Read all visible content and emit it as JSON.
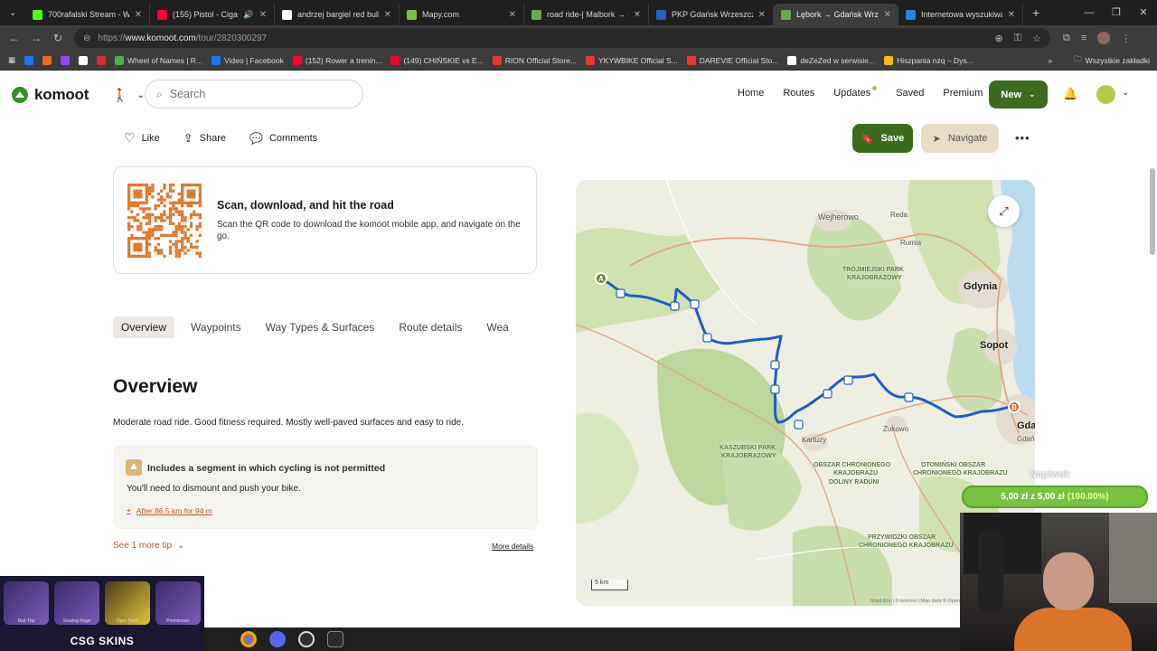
{
  "browser": {
    "tabs": [
      {
        "title": "700rafalski Stream - Watc",
        "color": "#53fc18"
      },
      {
        "title": "(155) Pistol - Cigarett",
        "color": "#ff0033",
        "audio": "🔊"
      },
      {
        "title": "andrzej bargiel red bull p",
        "color": "#ffffff"
      },
      {
        "title": "Mapy.com",
        "color": "#7bc043"
      },
      {
        "title": "road ride-| Malbork → Gd",
        "color": "#6aa84f"
      },
      {
        "title": "PKP Gdańsk Wrzeszcz > l",
        "color": "#2a5dbe"
      },
      {
        "title": "Lębork → Gdańsk Wrzesz",
        "color": "#6aa84f"
      },
      {
        "title": "Internetowa wyszukiwark",
        "color": "#1e88e5"
      }
    ],
    "url_prefix": "https://",
    "url_host": "www.komoot.com",
    "url_path": "/tour/2820300297",
    "bookmarks": [
      {
        "label": "",
        "color": "#1877f2"
      },
      {
        "label": "",
        "color": "#f06a2a"
      },
      {
        "label": "",
        "color": "#9146ff"
      },
      {
        "label": "",
        "color": "#ffffff"
      },
      {
        "label": "",
        "color": "#d32f2f"
      },
      {
        "label": "Wheel of Names | R...",
        "color": "#4caf50"
      },
      {
        "label": "Video | Facebook",
        "color": "#1877f2"
      },
      {
        "label": "(152) Rower a trenin...",
        "color": "#ff0033"
      },
      {
        "label": "(149) CHIŃSKIE vs E...",
        "color": "#ff0033"
      },
      {
        "label": "RION Official Store...",
        "color": "#e53935"
      },
      {
        "label": "YKYWBIKE Official S...",
        "color": "#e53935"
      },
      {
        "label": "DAREVIE Official Sto...",
        "color": "#e53935"
      },
      {
        "label": "deZeZed w serwisie...",
        "color": "#ffffff"
      },
      {
        "label": "Hiszpania nzq – Dys...",
        "color": "#fbbc04"
      }
    ],
    "all_bookmarks": "Wszystkie zakładki"
  },
  "header": {
    "logo": "komoot",
    "search_placeholder": "Search",
    "nav": [
      "Home",
      "Routes",
      "Updates",
      "Saved",
      "Premium"
    ],
    "new_label": "New"
  },
  "actions": {
    "like": "Like",
    "share": "Share",
    "comments": "Comments",
    "save": "Save",
    "navigate": "Navigate"
  },
  "qr_card": {
    "title": "Scan, download, and hit the road",
    "text": "Scan the QR code to download the komoot mobile app, and navigate on the go."
  },
  "subtabs": [
    "Overview",
    "Waypoints",
    "Way Types & Surfaces",
    "Route details",
    "Wea"
  ],
  "overview": {
    "title": "Overview",
    "text": "Moderate road ride. Good fitness required. Mostly well-paved surfaces and easy to ride.",
    "tip_title": "Includes a segment in which cycling is not permitted",
    "tip_text": "You'll need to dismount and push your bike.",
    "tip_link": "After 86.5 km for 94 m",
    "see_more": "See 1 more tip",
    "more_details": "More details",
    "next_heading_partial": "s"
  },
  "map": {
    "labels": [
      {
        "text": "Wejherowo"
      },
      {
        "text": "Reda"
      },
      {
        "text": "Rumia"
      },
      {
        "text": "TRÓJMIEJSKI PARK"
      },
      {
        "text": "KRAJOBRAZOWY"
      },
      {
        "text": "Gdynia"
      },
      {
        "text": "Sopot"
      },
      {
        "text": "Gda"
      },
      {
        "text": "Gdań"
      },
      {
        "text": "Żukowo"
      },
      {
        "text": "Kartuzy"
      },
      {
        "text": "KASZUBSKI PARK"
      },
      {
        "text": "KRAJOBRAZOWY"
      },
      {
        "text": "OBSZAR CHRONIONEGO"
      },
      {
        "text": "KRAJOBRAZU"
      },
      {
        "text": "DOLINY RADUNI"
      },
      {
        "text": "OTOMIŃSKI OBSZAR"
      },
      {
        "text": "CHRONIONEGO KRAJOBRAZU"
      },
      {
        "text": "PRZYWIDZKI OBSZAR"
      },
      {
        "text": "CHRONIONEGO KRAJOBRAZU"
      }
    ],
    "start_marker": "A",
    "end_marker": "B",
    "scale": "5 km",
    "attribution": "MapLibre | © komoot | Map data © OpenStreetMap"
  },
  "overlays": {
    "napiwek": "Napiwek",
    "donation_amount": "5,00 zł z 5,00 zł",
    "donation_pct": "(100.00%)",
    "promo_brand": "CSG SKINS",
    "promo_skins": [
      "Bad Trip",
      "Searing Rage",
      "Tiger Tooth",
      "Printstream"
    ]
  },
  "colors": {
    "brand_green": "#3c6b1e",
    "route_blue": "#1f5ec7",
    "link_orange": "#c7552b"
  }
}
